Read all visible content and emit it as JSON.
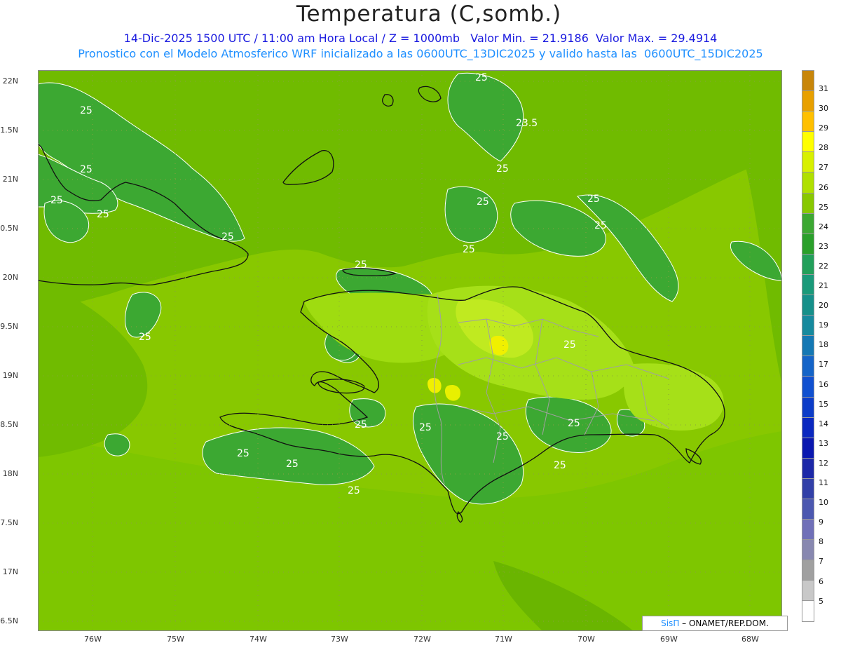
{
  "header": {
    "title": "Temperatura (C,somb.)",
    "subtitle_line1": "14-Dic-2025 1500 UTC / 11:00 am Hora Local / Z = 1000mb   Valor Min. = 21.9186  Valor Max. = 29.4914",
    "subtitle_line2": "Pronostico con el Modelo Atmosferico WRF inicializado a las 0600UTC_13DIC2025 y valido hasta las  0600UTC_15DIC2025"
  },
  "axes": {
    "lat_labels": [
      "22N",
      "21.5N",
      "21N",
      "20.5N",
      "20N",
      "19.5N",
      "19N",
      "18.5N",
      "18N",
      "17.5N",
      "17N",
      "16.5N"
    ],
    "lon_labels": [
      "76W",
      "75W",
      "74W",
      "73W",
      "72W",
      "71W",
      "70W",
      "69W",
      "68W"
    ]
  },
  "colorbar": {
    "labels": [
      "31",
      "30",
      "29",
      "28",
      "27",
      "26",
      "25",
      "24",
      "23",
      "22",
      "21",
      "20",
      "19",
      "18",
      "17",
      "16",
      "15",
      "14",
      "13",
      "12",
      "11",
      "10",
      "9",
      "8",
      "7",
      "6",
      "5"
    ],
    "colors": [
      "#c8860a",
      "#e8a000",
      "#ffc000",
      "#ffff00",
      "#d8f000",
      "#b0e000",
      "#88c800",
      "#3ca832",
      "#2aa02a",
      "#22a05a",
      "#1a9a7a",
      "#16908a",
      "#168a9e",
      "#1478b4",
      "#1464c8",
      "#1050d0",
      "#0c3cc8",
      "#0a28c0",
      "#0a18b0",
      "#1c28a8",
      "#3240a8",
      "#4c58b0",
      "#7070b8",
      "#8888b0",
      "#a0a0a0",
      "#c8c8c8",
      "#ffffff"
    ]
  },
  "contour_labels": [
    "25",
    "25",
    "25",
    "25",
    "25",
    "25",
    "25",
    "25",
    "25",
    "25",
    "25",
    "25",
    "25",
    "25",
    "25",
    "25",
    "25",
    "25",
    "25",
    "23.5"
  ],
  "credit": {
    "brand": "SisΠ",
    "text": "– ONAMET/REP.DOM."
  }
}
